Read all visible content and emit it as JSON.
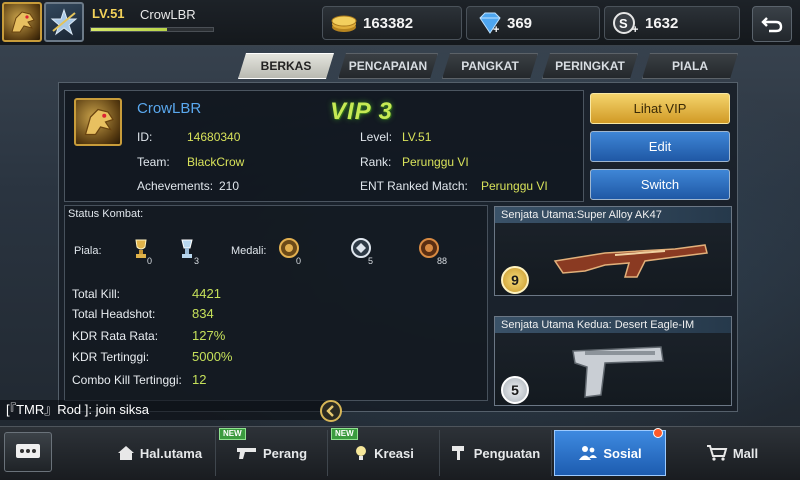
{
  "player": {
    "level": "LV.51",
    "name": "CrowLBR",
    "xp_fraction": 0.62
  },
  "currency": {
    "gold": "163382",
    "diamond": "369",
    "silver": "1632"
  },
  "tabs": [
    "BERKAS",
    "PENCAPAIAN",
    "PANGKAT",
    "PERINGKAT",
    "PIALA"
  ],
  "active_tab": "BERKAS",
  "profile": {
    "name": "CrowLBR",
    "vip": "VIP 3",
    "id_label": "ID:",
    "id": "14680340",
    "team_label": "Team:",
    "team": "BlackCrow",
    "ach_label": "Achevements:",
    "achievements": "210",
    "level_label": "Level:",
    "level": "LV.51",
    "rank_label": "Rank:",
    "rank": "Perunggu VI",
    "ent_label": "ENT Ranked Match:",
    "ent_rank": "Perunggu VI"
  },
  "buttons": {
    "vip": "Lihat VIP",
    "edit": "Edit",
    "switch": "Switch"
  },
  "status": {
    "title": "Status Kombat:",
    "piala_label": "Piala:",
    "piala": [
      "0",
      "3"
    ],
    "medali_label": "Medali:",
    "medali": [
      "0",
      "5",
      "88"
    ],
    "stats": [
      {
        "label": "Total Kill:",
        "value": "4421"
      },
      {
        "label": "Total Headshot:",
        "value": "834"
      },
      {
        "label": "KDR Rata Rata:",
        "value": "127%"
      },
      {
        "label": "KDR Tertinggi:",
        "value": "5000%"
      },
      {
        "label": "Combo Kill Tertinggi:",
        "value": "12"
      }
    ]
  },
  "weapons": [
    {
      "title": "Senjata Utama:Super Alloy AK47",
      "level": "9"
    },
    {
      "title": "Senjata Utama Kedua: Desert Eagle-IM",
      "level": "5"
    }
  ],
  "chat": {
    "text": "[『TMR』Rod ]: join siksa"
  },
  "nav": [
    {
      "label": "Hal.utama",
      "icon": "home-icon",
      "new": false
    },
    {
      "label": "Perang",
      "icon": "pistol-icon",
      "new": true,
      "badge": "NEW"
    },
    {
      "label": "Kreasi",
      "icon": "bulb-icon",
      "new": true,
      "badge": "NEW"
    },
    {
      "label": "Penguatan",
      "icon": "hammer-icon",
      "new": false
    },
    {
      "label": "Sosial",
      "icon": "people-icon",
      "new": false,
      "active": true
    },
    {
      "label": "Mall",
      "icon": "cart-icon",
      "new": false
    }
  ],
  "colors": {
    "accent_gold": "#d19a26",
    "accent_blue": "#1f58a5",
    "value_green": "#c5e05a",
    "vip_green": "#c6ea54"
  }
}
